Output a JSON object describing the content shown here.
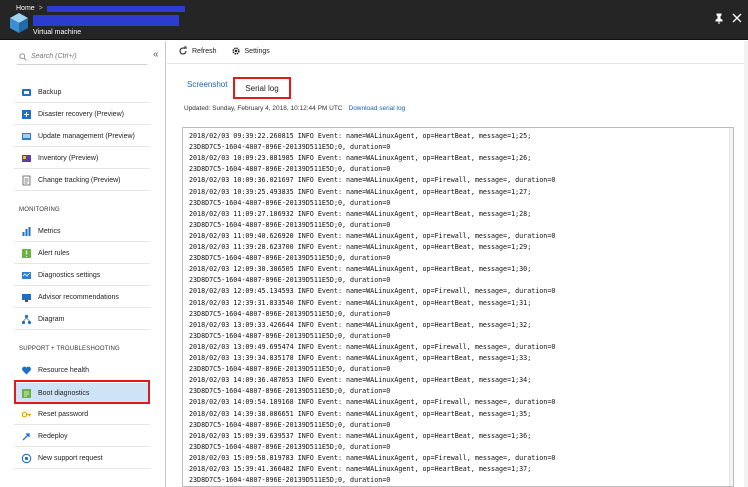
{
  "header": {
    "breadcrumb_home": "Home",
    "breadcrumb_sep": ">",
    "subtitle": "Virtual machine",
    "pin_glyph": "📌",
    "close_glyph": "✕"
  },
  "sidebar": {
    "search_placeholder": "Search (Ctrl+/)",
    "collapse_glyph": "«",
    "items_top": [
      {
        "label": "Backup",
        "icon": "backup-icon"
      },
      {
        "label": "Disaster recovery (Preview)",
        "icon": "disaster-recovery-icon"
      },
      {
        "label": "Update management (Preview)",
        "icon": "update-management-icon"
      },
      {
        "label": "Inventory (Preview)",
        "icon": "inventory-icon"
      },
      {
        "label": "Change tracking (Preview)",
        "icon": "change-tracking-icon"
      }
    ],
    "monitoring_header": "MONITORING",
    "items_monitoring": [
      {
        "label": "Metrics",
        "icon": "metrics-icon"
      },
      {
        "label": "Alert rules",
        "icon": "alert-rules-icon"
      },
      {
        "label": "Diagnostics settings",
        "icon": "diagnostics-settings-icon"
      },
      {
        "label": "Advisor recommendations",
        "icon": "advisor-icon"
      },
      {
        "label": "Diagram",
        "icon": "diagram-icon"
      }
    ],
    "support_header": "SUPPORT + TROUBLESHOOTING",
    "items_support": [
      {
        "label": "Resource health",
        "icon": "resource-health-icon"
      },
      {
        "label": "Boot diagnostics",
        "icon": "boot-diagnostics-icon",
        "active": true
      },
      {
        "label": "Reset password",
        "icon": "key-icon"
      },
      {
        "label": "Redeploy",
        "icon": "redeploy-icon"
      },
      {
        "label": "New support request",
        "icon": "support-request-icon"
      }
    ]
  },
  "toolbar": {
    "refresh_label": "Refresh",
    "settings_label": "Settings"
  },
  "tabs": {
    "screenshot_label": "Screenshot",
    "serial_log_label": "Serial log"
  },
  "updated": {
    "text": "Updated: Sunday, February 4, 2018, 10:12:44 PM UTC",
    "download_label": "Download serial log"
  },
  "log_lines": [
    "2018/02/03 09:39:22.260815 INFO Event: name=WALinuxAgent, op=HeartBeat, message=1;25;",
    "23D8D7C5-1604-4807-896E-20139D511E5D;0, duration=0",
    "2018/02/03 10:09:23.881985 INFO Event: name=WALinuxAgent, op=HeartBeat, message=1;26;",
    "23D8D7C5-1604-4807-896E-20139D511E5D;0, duration=0",
    "2018/02/03 10:09:36.021697 INFO Event: name=WALinuxAgent, op=Firewall, message=, duration=0",
    "2018/02/03 10:39:25.493835 INFO Event: name=WALinuxAgent, op=HeartBeat, message=1;27;",
    "23D8D7C5-1604-4807-896E-20139D511E5D;0, duration=0",
    "2018/02/03 11:09:27.106932 INFO Event: name=WALinuxAgent, op=HeartBeat, message=1;28;",
    "23D8D7C5-1604-4807-896E-20139D511E5D;0, duration=0",
    "2018/02/03 11:09:40.626920 INFO Event: name=WALinuxAgent, op=Firewall, message=, duration=0",
    "2018/02/03 11:39:28.623700 INFO Event: name=WALinuxAgent, op=HeartBeat, message=1;29;",
    "23D8D7C5-1604-4807-896E-20139D511E5D;0, duration=0",
    "2018/02/03 12:09:30.306505 INFO Event: name=WALinuxAgent, op=HeartBeat, message=1;30;",
    "23D8D7C5-1604-4807-896E-20139D511E5D;0, duration=0",
    "2018/02/03 12:09:45.134593 INFO Event: name=WALinuxAgent, op=Firewall, message=, duration=0",
    "2018/02/03 12:39:31.833540 INFO Event: name=WALinuxAgent, op=HeartBeat, message=1;31;",
    "23D8D7C5-1604-4807-896E-20139D511E5D;0, duration=0",
    "2018/02/03 13:09:33.426644 INFO Event: name=WALinuxAgent, op=HeartBeat, message=1;32;",
    "23D8D7C5-1604-4807-896E-20139D511E5D;0, duration=0",
    "2018/02/03 13:09:49.695474 INFO Event: name=WALinuxAgent, op=Firewall, message=, duration=0",
    "2018/02/03 13:39:34.835178 INFO Event: name=WALinuxAgent, op=HeartBeat, message=1;33;",
    "23D8D7C5-1604-4807-896E-20139D511E5D;0, duration=0",
    "2018/02/03 14:09:36.487053 INFO Event: name=WALinuxAgent, op=HeartBeat, message=1;34;",
    "23D8D7C5-1604-4807-896E-20139D511E5D;0, duration=0",
    "2018/02/03 14:09:54.189168 INFO Event: name=WALinuxAgent, op=Firewall, message=, duration=0",
    "2018/02/03 14:39:38.086651 INFO Event: name=WALinuxAgent, op=HeartBeat, message=1;35;",
    "23D8D7C5-1604-4807-896E-20139D511E5D;0, duration=0",
    "2018/02/03 15:09:39.639537 INFO Event: name=WALinuxAgent, op=HeartBeat, message=1;36;",
    "23D8D7C5-1604-4807-896E-20139D511E5D;0, duration=0",
    "2018/02/03 15:09:58.819783 INFO Event: name=WALinuxAgent, op=Firewall, message=, duration=0",
    "2018/02/03 15:39:41.366482 INFO Event: name=WALinuxAgent, op=HeartBeat, message=1;37;",
    "23D8D7C5-1604-4807-896E-20139D511E5D;0, duration=0"
  ],
  "colors": {
    "header_bg": "#252526",
    "redaction": "#2b3cd0",
    "highlight": "#e01b1b",
    "link": "#1a64b0",
    "active_item": "#cfe3f6"
  }
}
